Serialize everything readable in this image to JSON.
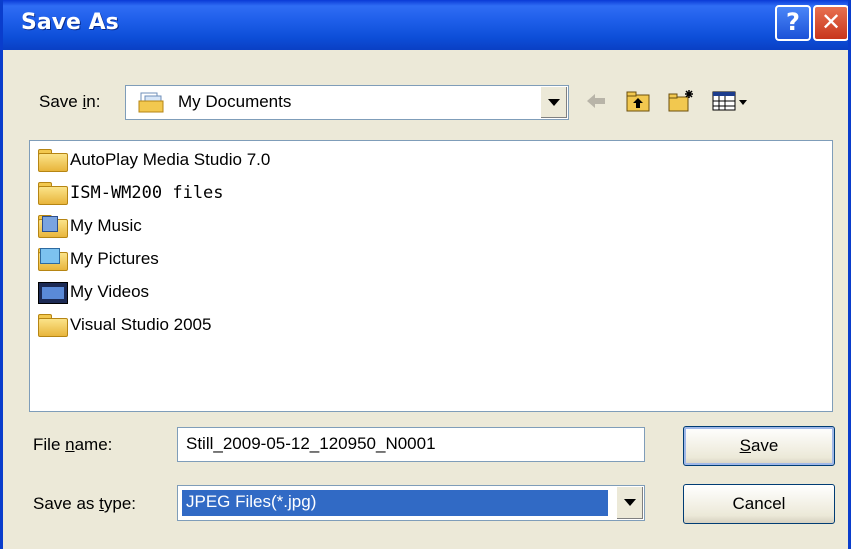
{
  "window": {
    "title": "Save As",
    "help_glyph": "?",
    "close_glyph": "✕"
  },
  "save_in": {
    "label_pre": "Save ",
    "label_accel": "i",
    "label_post": "n:",
    "value": "My Documents",
    "icon": "documents-folder-icon"
  },
  "toolbar": {
    "icons": [
      "back-arrow-icon",
      "up-one-level-icon",
      "new-folder-icon",
      "view-menu-icon"
    ]
  },
  "files": [
    {
      "name": "AutoPlay Media Studio 7.0",
      "icon": "folder-icon"
    },
    {
      "name": "ISM-WM200 files",
      "icon": "folder-icon"
    },
    {
      "name": "My Music",
      "icon": "music-folder-icon"
    },
    {
      "name": "My Pictures",
      "icon": "pictures-folder-icon"
    },
    {
      "name": "My Videos",
      "icon": "videos-folder-icon"
    },
    {
      "name": "Visual Studio 2005",
      "icon": "folder-icon"
    }
  ],
  "file_name": {
    "label_pre": "File ",
    "label_accel": "n",
    "label_post": "ame:",
    "value": "Still_2009-05-12_120950_N0001"
  },
  "save_type": {
    "label_pre": "Save as ",
    "label_accel": "t",
    "label_post": "ype:",
    "value": "JPEG Files(*.jpg)"
  },
  "buttons": {
    "save_accel": "S",
    "save_rest": "ave",
    "cancel": "Cancel"
  },
  "colors": {
    "title_bar": "#0a3ad6",
    "dialog_bg": "#ece9d8",
    "selection": "#316ac5"
  }
}
